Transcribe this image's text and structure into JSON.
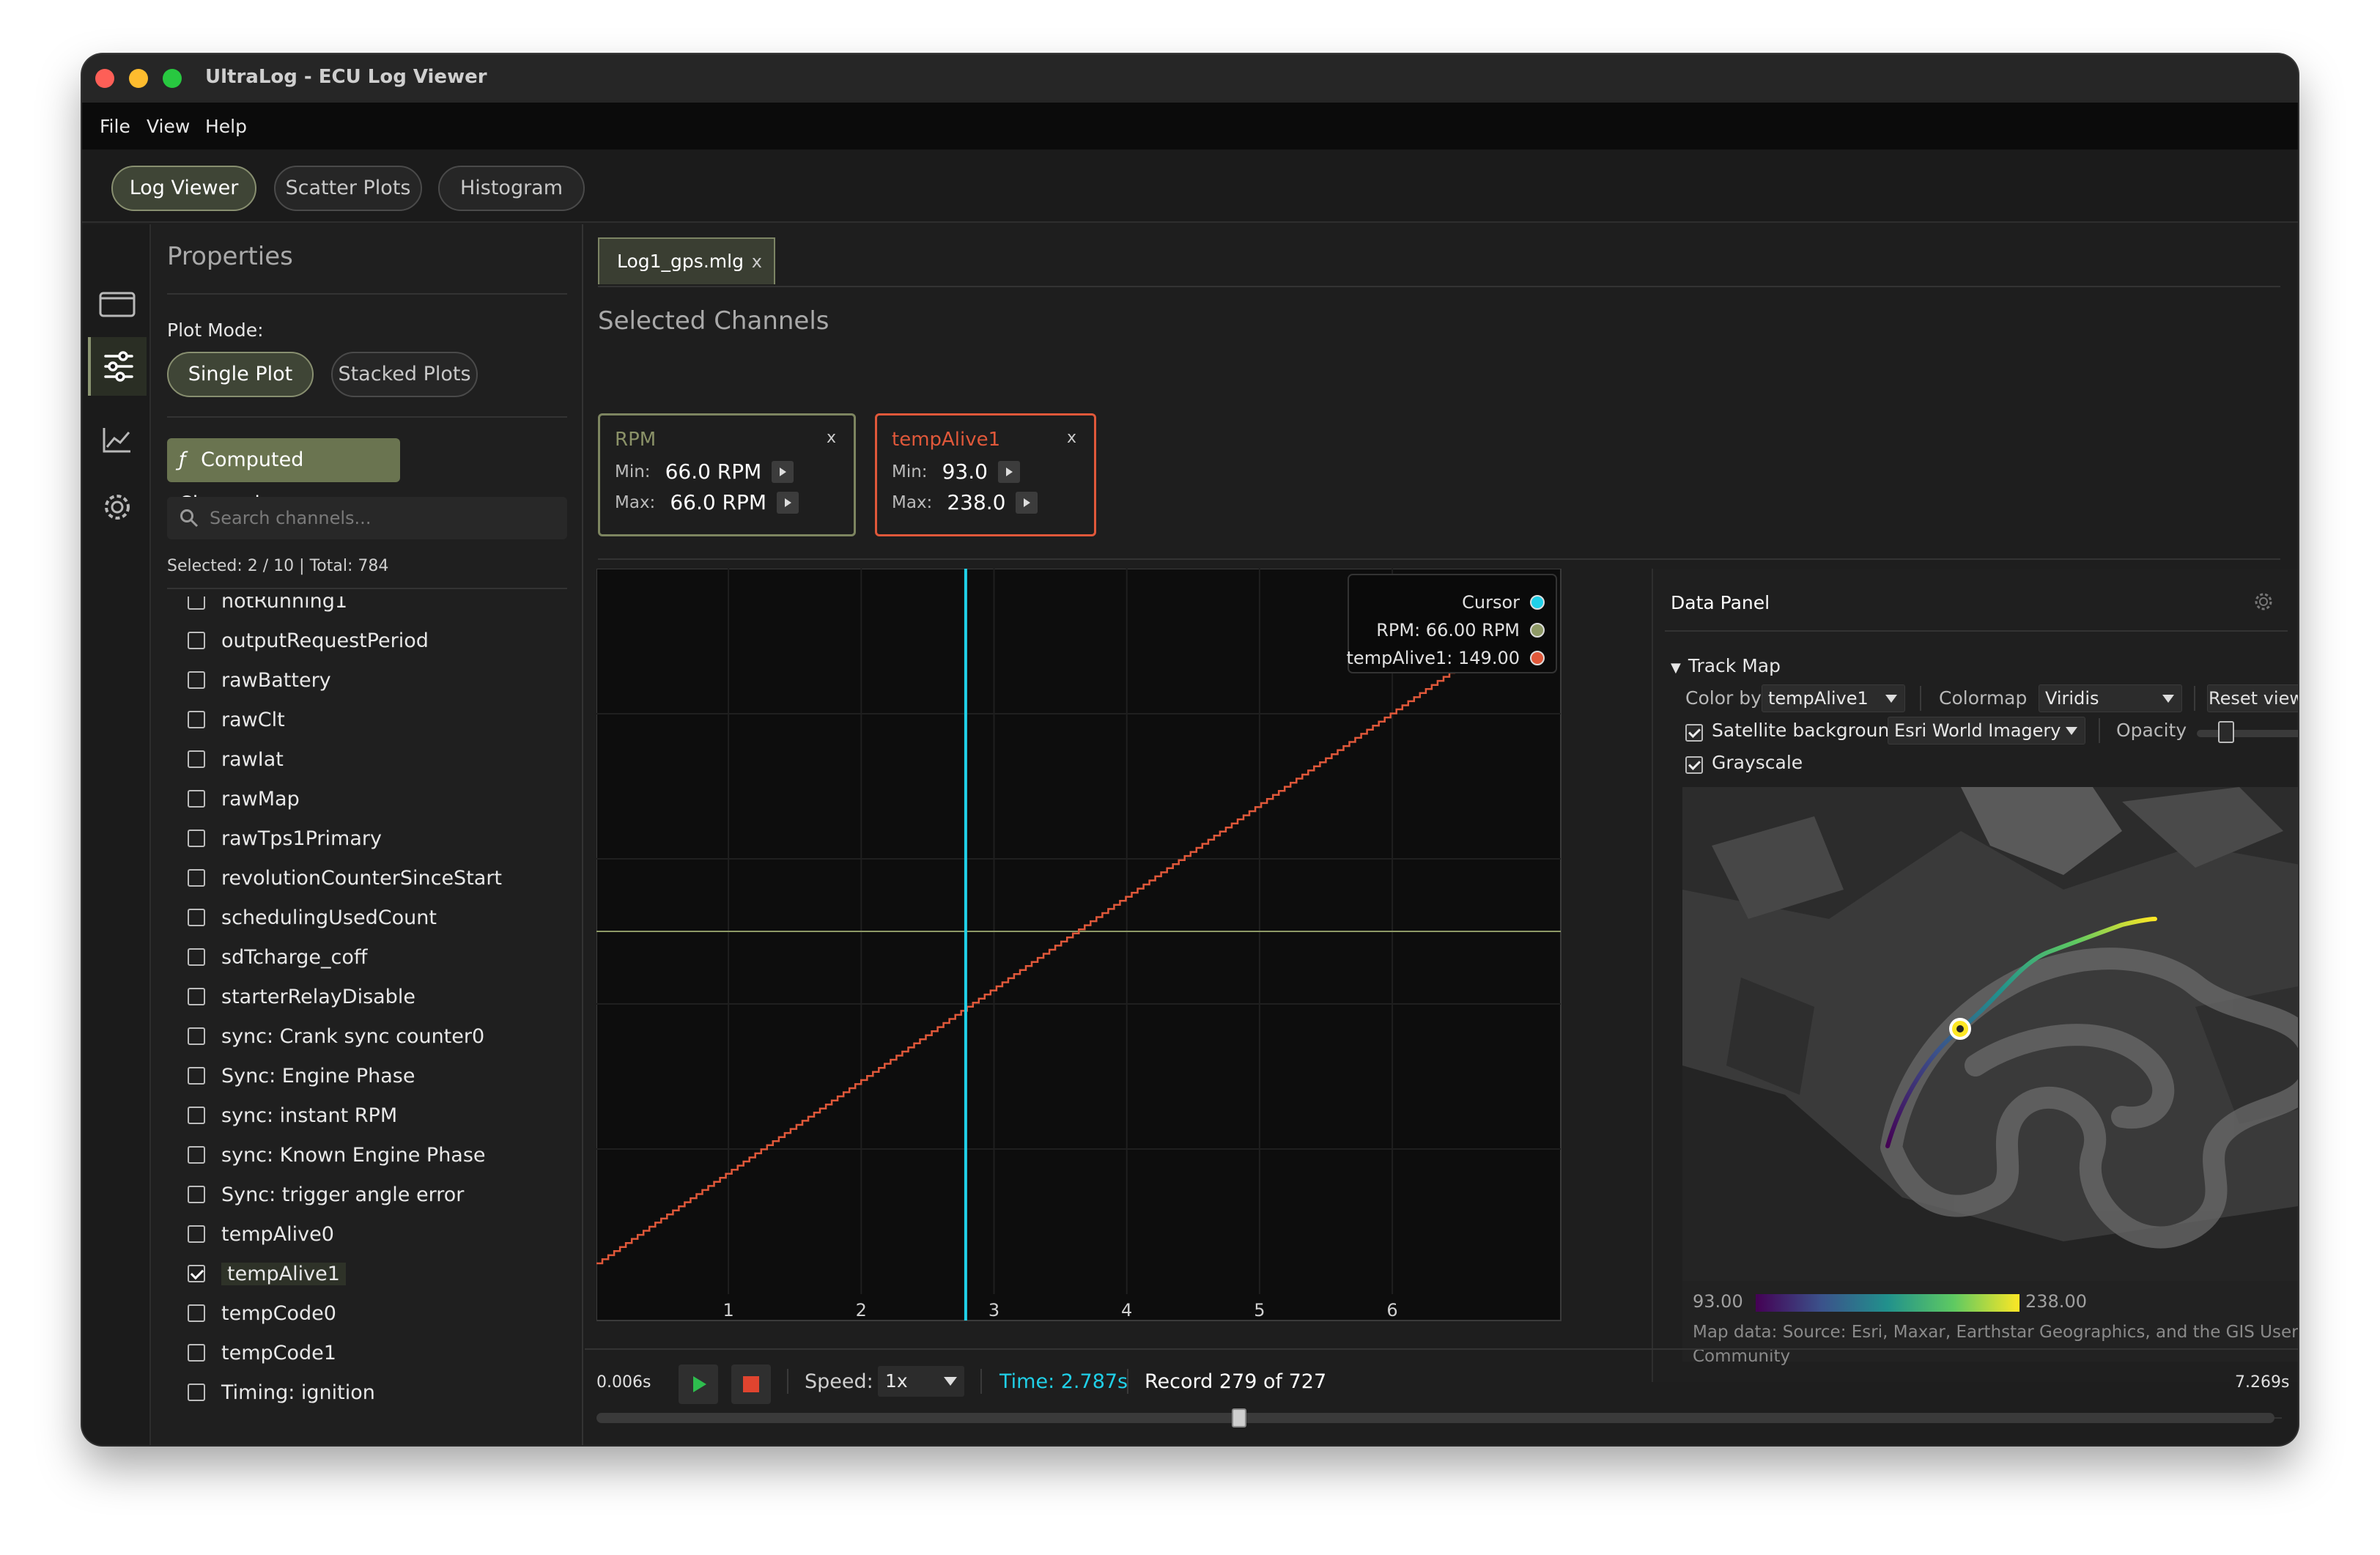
{
  "window": {
    "title": "UltraLog - ECU Log Viewer"
  },
  "menu": [
    "File",
    "View",
    "Help"
  ],
  "tabs": [
    {
      "label": "Log Viewer",
      "active": true
    },
    {
      "label": "Scatter Plots",
      "active": false
    },
    {
      "label": "Histogram",
      "active": false
    }
  ],
  "rail": {
    "icons": [
      "folder-icon",
      "sliders-icon",
      "chart-icon",
      "gear-icon"
    ],
    "active_index": 1
  },
  "properties": {
    "title": "Properties",
    "plot_mode_label": "Plot Mode:",
    "plot_modes": [
      {
        "label": "Single Plot",
        "active": true
      },
      {
        "label": "Stacked Plots",
        "active": false
      }
    ],
    "computed_channels_label": "Computed Channels",
    "computed_channels_icon": "ƒ",
    "search_placeholder": "Search channels...",
    "selected_info": "Selected: 2 / 10 | Total: 784",
    "channels": [
      {
        "name": "notRunning1",
        "checked": false
      },
      {
        "name": "outputRequestPeriod",
        "checked": false
      },
      {
        "name": "rawBattery",
        "checked": false
      },
      {
        "name": "rawClt",
        "checked": false
      },
      {
        "name": "rawIat",
        "checked": false
      },
      {
        "name": "rawMap",
        "checked": false
      },
      {
        "name": "rawTps1Primary",
        "checked": false
      },
      {
        "name": "revolutionCounterSinceStart",
        "checked": false
      },
      {
        "name": "schedulingUsedCount",
        "checked": false
      },
      {
        "name": "sdTcharge_coff",
        "checked": false
      },
      {
        "name": "starterRelayDisable",
        "checked": false
      },
      {
        "name": "sync: Crank sync counter0",
        "checked": false
      },
      {
        "name": "Sync: Engine Phase",
        "checked": false
      },
      {
        "name": "sync: instant RPM",
        "checked": false
      },
      {
        "name": "sync: Known Engine Phase",
        "checked": false
      },
      {
        "name": "Sync: trigger angle error",
        "checked": false
      },
      {
        "name": "tempAlive0",
        "checked": false
      },
      {
        "name": "tempAlive1",
        "checked": true
      },
      {
        "name": "tempCode0",
        "checked": false
      },
      {
        "name": "tempCode1",
        "checked": false
      },
      {
        "name": "Timing: ignition",
        "checked": false
      }
    ]
  },
  "file_tab": {
    "name": "Log1_gps.mlg",
    "close": "x"
  },
  "selected_channels": {
    "title": "Selected Channels",
    "min_label": "Min:",
    "max_label": "Max:",
    "cards": [
      {
        "name": "RPM",
        "min": "66.0 RPM",
        "max": "66.0 RPM",
        "color": "#7d8560"
      },
      {
        "name": "tempAlive1",
        "min": "93.0",
        "max": "238.0",
        "color": "#e0583a"
      }
    ]
  },
  "chart_data": {
    "type": "line",
    "x_ticks": [
      1,
      2,
      3,
      4,
      5,
      6
    ],
    "xlim": [
      0.006,
      7.269
    ],
    "cursor_x": 2.787,
    "series": [
      {
        "name": "RPM",
        "color": "#8e9966",
        "x": [
          0.006,
          7.269
        ],
        "y": [
          66.0,
          66.0
        ]
      },
      {
        "name": "tempAlive1",
        "color": "#e0583a",
        "x": [
          0.006,
          6.43
        ],
        "y": [
          93.0,
          238.0
        ]
      }
    ],
    "legend": {
      "cursor_label": "Cursor",
      "cursor_color": "#20d0e8",
      "entries": [
        "RPM: 66.00 RPM",
        "tempAlive1: 149.00"
      ],
      "position": "top-right"
    }
  },
  "data_panel": {
    "title": "Data Panel",
    "track_map": {
      "header": "Track Map",
      "color_by_label": "Color by",
      "color_by_value": "tempAlive1",
      "colormap_label": "Colormap",
      "colormap_value": "Viridis",
      "reset_label": "Reset view",
      "satellite_label": "Satellite background",
      "satellite_value": "Esri World Imagery",
      "opacity_label": "Opacity",
      "opacity": 0.2,
      "grayscale_label": "Grayscale",
      "scale_min": "93.00",
      "scale_max": "238.00",
      "attribution": "Map data: Source: Esri, Maxar, Earthstar Geographics, and the GIS User Community"
    }
  },
  "playback": {
    "speed_label": "Speed:",
    "speed_value": "1x",
    "time": "Time: 2.787s",
    "record": "Record 279 of 727",
    "start": "0.006s",
    "end": "7.269s",
    "position": 0.3829
  }
}
